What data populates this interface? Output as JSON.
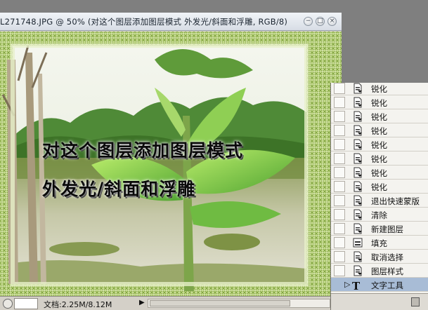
{
  "document": {
    "title": "L271748.JPG @ 50% (对这个图层添加图层模式 外发光/斜面和浮雕, RGB/8)",
    "status_text": "文档:2.25M/8.12M",
    "status_arrow": "▶"
  },
  "canvas_text": {
    "line1": "对这个图层添加图层模式",
    "line2": "外发光/斜面和浮雕"
  },
  "window_controls": {
    "minimize": "−",
    "maximize": "□",
    "close": "×"
  },
  "history": {
    "items": [
      {
        "label": "锐化",
        "icon": "document-step-icon"
      },
      {
        "label": "锐化",
        "icon": "document-step-icon"
      },
      {
        "label": "锐化",
        "icon": "document-step-icon"
      },
      {
        "label": "锐化",
        "icon": "document-step-icon"
      },
      {
        "label": "锐化",
        "icon": "document-step-icon"
      },
      {
        "label": "锐化",
        "icon": "document-step-icon"
      },
      {
        "label": "锐化",
        "icon": "document-step-icon"
      },
      {
        "label": "锐化",
        "icon": "document-step-icon"
      },
      {
        "label": "退出快速蒙版",
        "icon": "document-step-icon"
      },
      {
        "label": "清除",
        "icon": "document-step-icon"
      },
      {
        "label": "新建图层",
        "icon": "document-step-icon"
      },
      {
        "label": "填充",
        "icon": "fill-icon"
      },
      {
        "label": "取消选择",
        "icon": "document-step-icon"
      },
      {
        "label": "图层样式",
        "icon": "document-step-icon"
      },
      {
        "label": "文字工具",
        "icon": "text-tool-icon",
        "active": true
      }
    ],
    "active_marker": "▷",
    "text_icon_glyph": "T",
    "active_color": "#a8bcd6"
  }
}
